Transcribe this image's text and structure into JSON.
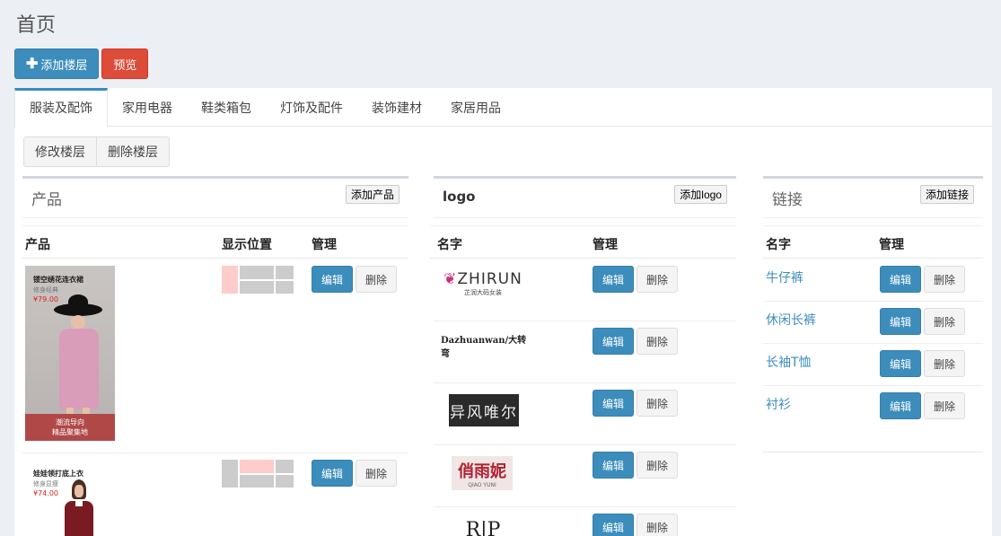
{
  "page_title": "首页",
  "top_actions": {
    "add_floor": "添加楼层",
    "preview": "预览"
  },
  "tabs": [
    "服装及配饰",
    "家用电器",
    "鞋类箱包",
    "灯饰及配件",
    "装饰建材",
    "家居用品"
  ],
  "floor_actions": {
    "edit": "修改楼层",
    "delete": "删除楼层"
  },
  "products": {
    "title": "产品",
    "add": "添加产品",
    "columns": [
      "产品",
      "显示位置",
      "管理"
    ],
    "items": [
      {
        "headline": "镂空绣花连衣裙",
        "sub": "修身经典",
        "price": "¥79.00",
        "banner1": "潮流导向",
        "banner2": "精品聚集地"
      },
      {
        "headline": "娃娃领打底上衣",
        "sub": "修身显瘦",
        "price": "¥74.00"
      }
    ]
  },
  "logos": {
    "title": "logo",
    "add": "添加logo",
    "columns": [
      "名字",
      "管理"
    ],
    "items": [
      {
        "main": "ZHIRUN",
        "sub": "芷润大码女装"
      },
      {
        "main": "Dazhuanwan/大转弯"
      },
      {
        "main": "异风唯尔"
      },
      {
        "main": "俏雨妮",
        "sub": "QIAO YUNI"
      },
      {
        "main": "R|P"
      }
    ]
  },
  "links": {
    "title": "链接",
    "add": "添加链接",
    "columns": [
      "名字",
      "管理"
    ],
    "items": [
      "牛仔裤",
      "休闲长裤",
      "长袖T恤",
      "衬衫"
    ]
  },
  "btn_labels": {
    "edit": "编辑",
    "delete": "删除"
  },
  "colors": {
    "primary": "#3c8dbc",
    "danger": "#dd4b39",
    "highlight": "#ffcccc"
  }
}
